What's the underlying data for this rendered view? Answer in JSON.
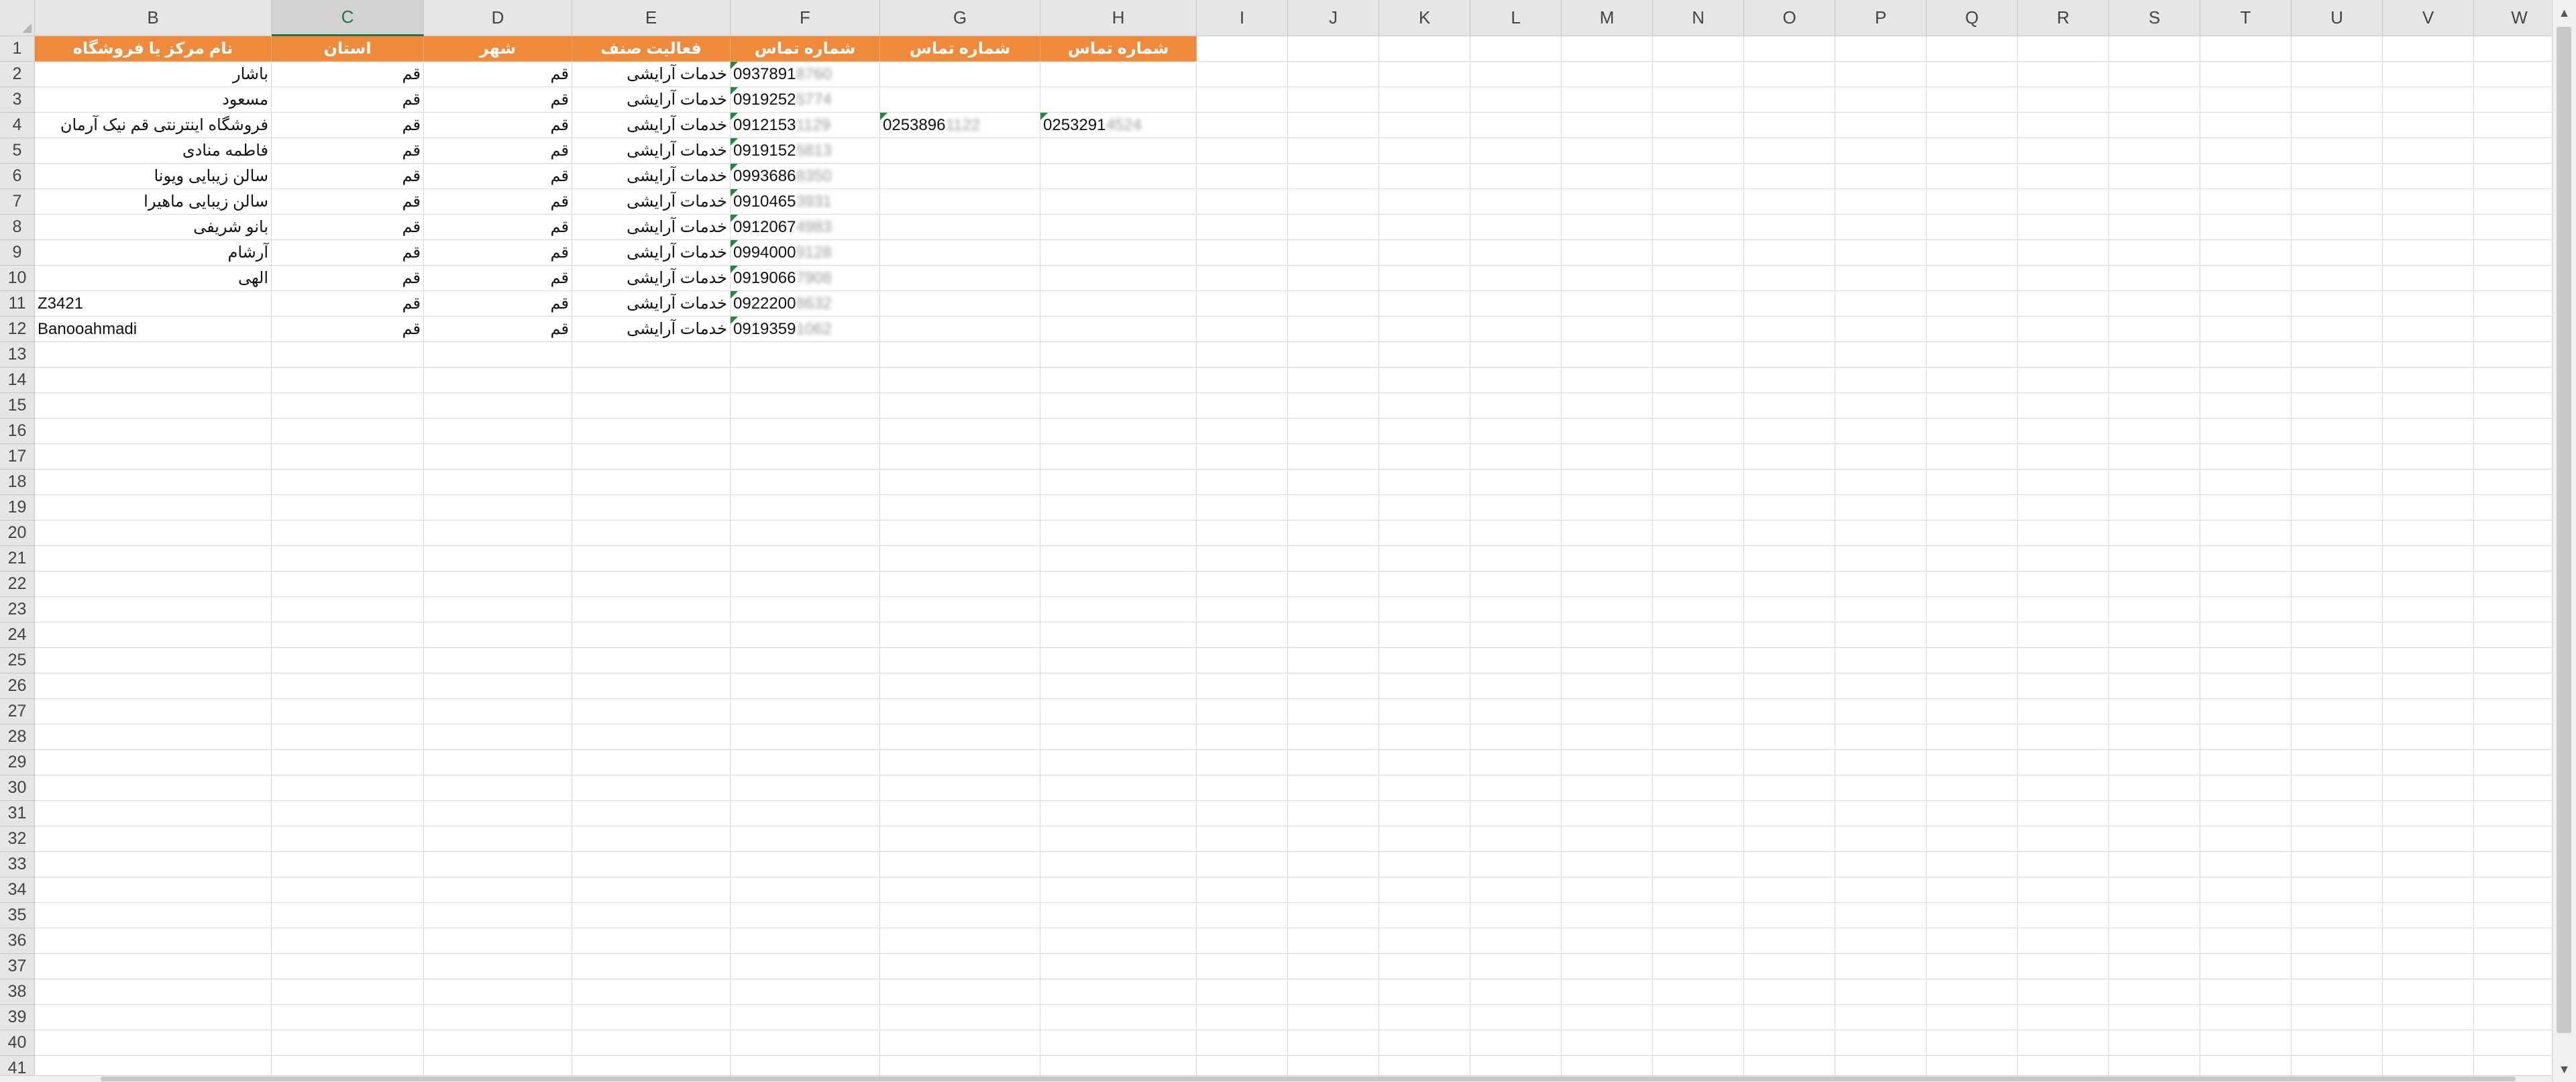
{
  "columns": [
    "B",
    "C",
    "D",
    "E",
    "F",
    "G",
    "H",
    "I",
    "J",
    "K",
    "L",
    "M",
    "N",
    "O",
    "P",
    "Q",
    "R",
    "S",
    "T",
    "U",
    "V",
    "W"
  ],
  "selected_column": "C",
  "header_fill_color": "#ef8a3a",
  "header_text_color": "#ffffff",
  "selection_color": "#217346",
  "row_numbers": [
    "1",
    "2",
    "3",
    "4",
    "5",
    "6",
    "7",
    "8",
    "9",
    "10",
    "11",
    "12",
    "13",
    "14",
    "15",
    "16",
    "17",
    "18",
    "19",
    "20",
    "21",
    "22",
    "23",
    "24",
    "25",
    "26",
    "27",
    "28",
    "29",
    "30",
    "31",
    "32",
    "33",
    "34",
    "35",
    "36",
    "37",
    "38",
    "39",
    "40",
    "41"
  ],
  "header_row": {
    "B": "نام مرکز یا فروشگاه",
    "C": "استان",
    "D": "شهر",
    "E": "فعالیت صنف",
    "F": "شماره تماس",
    "G": "شماره تماس",
    "H": "شماره تماس"
  },
  "rows": [
    {
      "B": "باشار",
      "C": "قم",
      "D": "قم",
      "E": "خدمات آرایشی",
      "F": "0937891",
      "F_hidden": "8760",
      "G": "",
      "G_hidden": "",
      "H": "",
      "H_hidden": ""
    },
    {
      "B": "مسعود",
      "C": "قم",
      "D": "قم",
      "E": "خدمات آرایشی",
      "F": "0919252",
      "F_hidden": "5774",
      "G": "",
      "G_hidden": "",
      "H": "",
      "H_hidden": ""
    },
    {
      "B": "فروشگاه اینترنتی قم نیک آرمان",
      "C": "قم",
      "D": "قم",
      "E": "خدمات آرایشی",
      "F": "0912153",
      "F_hidden": "1129",
      "G": "0253896",
      "G_hidden": "1122",
      "H": "0253291",
      "H_hidden": "4524"
    },
    {
      "B": "فاطمه منادی",
      "C": "قم",
      "D": "قم",
      "E": "خدمات آرایشی",
      "F": "0919152",
      "F_hidden": "5813",
      "G": "",
      "G_hidden": "",
      "H": "",
      "H_hidden": ""
    },
    {
      "B": "سالن زیبایی ویونا",
      "C": "قم",
      "D": "قم",
      "E": "خدمات آرایشی",
      "F": "0993686",
      "F_hidden": "8350",
      "G": "",
      "G_hidden": "",
      "H": "",
      "H_hidden": ""
    },
    {
      "B": "سالن زیبایی ماهیرا",
      "C": "قم",
      "D": "قم",
      "E": "خدمات آرایشی",
      "F": "0910465",
      "F_hidden": "3931",
      "G": "",
      "G_hidden": "",
      "H": "",
      "H_hidden": ""
    },
    {
      "B": "بانو شریفی",
      "C": "قم",
      "D": "قم",
      "E": "خدمات آرایشی",
      "F": "0912067",
      "F_hidden": "4983",
      "G": "",
      "G_hidden": "",
      "H": "",
      "H_hidden": ""
    },
    {
      "B": "آرشام",
      "C": "قم",
      "D": "قم",
      "E": "خدمات آرایشی",
      "F": "0994000",
      "F_hidden": "9128",
      "G": "",
      "G_hidden": "",
      "H": "",
      "H_hidden": ""
    },
    {
      "B": "الهی",
      "C": "قم",
      "D": "قم",
      "E": "خدمات آرایشی",
      "F": "0919066",
      "F_hidden": "7908",
      "G": "",
      "G_hidden": "",
      "H": "",
      "H_hidden": ""
    },
    {
      "B": "Z3421",
      "C": "قم",
      "D": "قم",
      "E": "خدمات آرایشی",
      "F": "0922200",
      "F_hidden": "8632",
      "G": "",
      "G_hidden": "",
      "H": "",
      "H_hidden": ""
    },
    {
      "B": "Banooahmadi",
      "C": "قم",
      "D": "قم",
      "E": "خدمات آرایشی",
      "F": "0919359",
      "F_hidden": "1062",
      "G": "",
      "G_hidden": "",
      "H": "",
      "H_hidden": ""
    }
  ],
  "scrollbar": {
    "up_arrow": "▲",
    "down_arrow": "▼"
  }
}
